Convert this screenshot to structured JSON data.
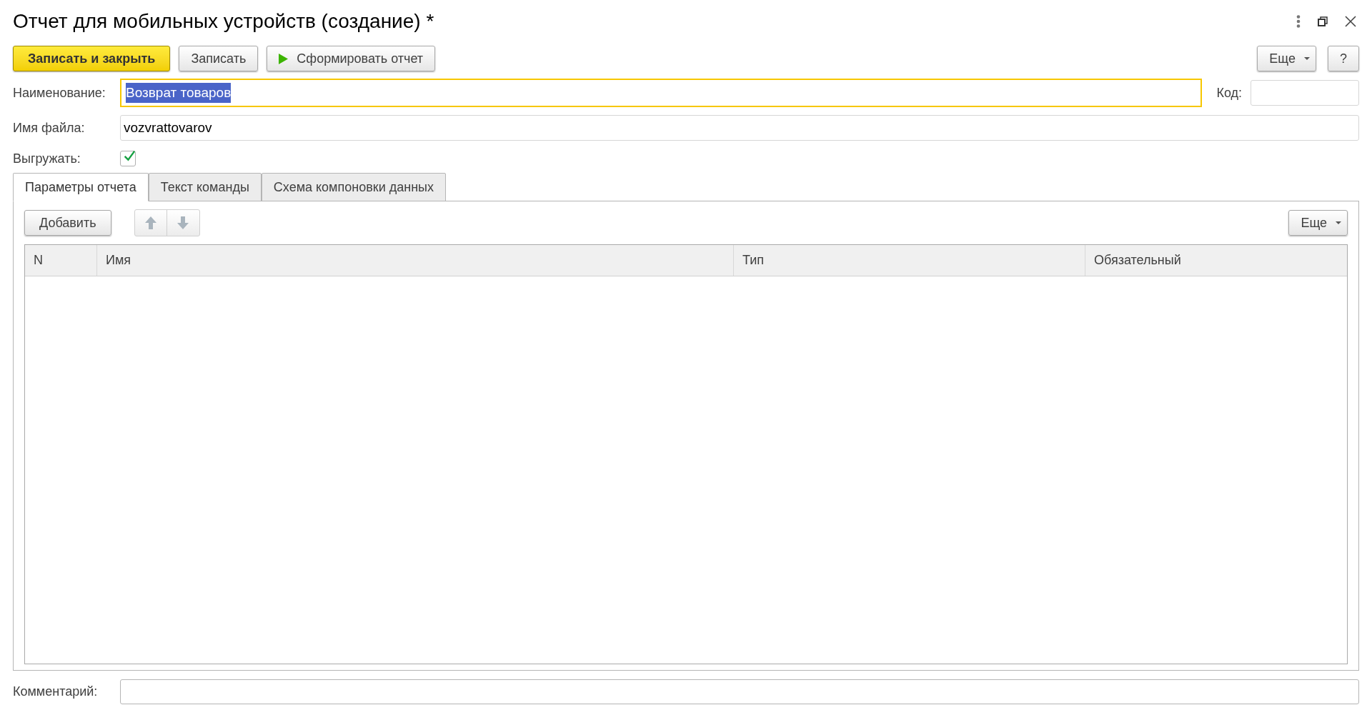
{
  "window": {
    "title": "Отчет для мобильных устройств (создание) *"
  },
  "toolbar": [
    {
      "kind": "default",
      "label": "Записать и закрыть"
    },
    {
      "kind": "plain",
      "label": "Записать"
    },
    {
      "kind": "run",
      "label": "Сформировать отчет"
    }
  ],
  "toolbar_right": {
    "more": "Еще",
    "help": "?"
  },
  "fields": {
    "name": {
      "label": "Наименование:",
      "value": "Возврат товаров",
      "focused": true,
      "text_selected": true
    },
    "code": {
      "label": "Код:"
    },
    "file": {
      "label": "Имя файла:",
      "value": "vozvrattovarov"
    },
    "export": {
      "label": "Выгружать:",
      "checked": true
    }
  },
  "tabs": [
    {
      "label": "Параметры отчета",
      "selected": true
    },
    {
      "label": "Текст команды",
      "selected": false
    },
    {
      "label": "Схема компоновки данных",
      "selected": false
    }
  ],
  "panel": {
    "add": "Добавить",
    "more": "Еще",
    "table": {
      "columns": [
        "N",
        "Имя",
        "Тип",
        "Обязательный"
      ]
    }
  },
  "comment": {
    "label": "Комментарий:"
  }
}
